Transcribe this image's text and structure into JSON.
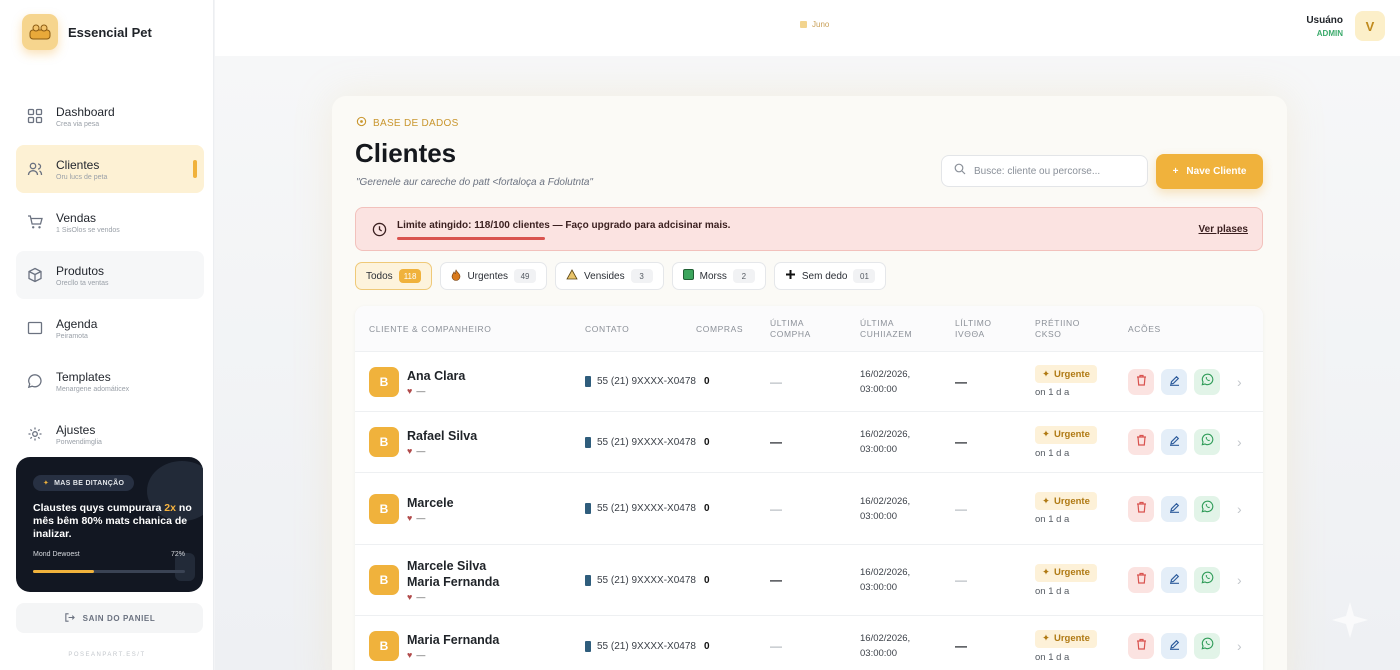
{
  "brand": {
    "name": "Essencial Pet",
    "logo_icon": "pet-logo-icon"
  },
  "sidebar": {
    "items": [
      {
        "label": "Dashboard",
        "sub": "Crea via pesa",
        "icon": "grid-icon",
        "key": "dashboard"
      },
      {
        "label": "Clientes",
        "sub": "Oru lucs de peta",
        "icon": "users-icon",
        "key": "clientes",
        "active": true
      },
      {
        "label": "Vendas",
        "sub": "1 SisOlos se vendos",
        "icon": "cart-icon",
        "key": "vendas"
      },
      {
        "label": "Produtos",
        "sub": "Orecllo ta ventas",
        "icon": "box-icon",
        "key": "produtos"
      },
      {
        "label": "Agenda",
        "sub": "Peiramota",
        "icon": "calendar-icon",
        "key": "agenda"
      },
      {
        "label": "Templates",
        "sub": "Menargene adomáticex",
        "icon": "chat-icon",
        "key": "templates"
      },
      {
        "label": "Ajustes",
        "sub": "Porwendimglia",
        "icon": "gear-icon",
        "key": "ajustes"
      }
    ],
    "promo": {
      "pill": "MAS BE DITANÇÃO",
      "title_pre": "Claustes quys cumpurara ",
      "title_hl": "2x",
      "title_post": " no mês bêm 80% mats chanica de inalizar.",
      "meta_label": "Mond Dewoest",
      "meta_value": "72%",
      "progress": 0.72
    },
    "logout": "SAIN DO PANIEL",
    "footer": "POSEANPART.ES/T"
  },
  "topbar": {
    "center": "Juno",
    "user_name": "Usuáno",
    "user_role": "ADMIN",
    "avatar_letter": "V"
  },
  "page": {
    "crumb": "BASE DE DADOS",
    "title": "Clientes",
    "subtitle": "\"Gerenele aur careche do patt <fortaloça a Fdolutnta\"",
    "search_placeholder": "Busce: cliente ou percorse...",
    "new_button": "Nave Cliente"
  },
  "alert": {
    "text": "Limite atingido: 118/100 clientes — Faço upgrado para adcisinar mais.",
    "link": "Ver plases"
  },
  "filters": [
    {
      "label": "Todos",
      "count": "118",
      "icon": "",
      "active": true
    },
    {
      "label": "Urgentes",
      "count": "49",
      "icon": "fire-icon"
    },
    {
      "label": "Vensides",
      "count": "3",
      "icon": "warning-icon"
    },
    {
      "label": "Morss",
      "count": "2",
      "icon": "green-square-icon"
    },
    {
      "label": "Sem dedo",
      "count": "01",
      "icon": "plus-icon"
    }
  ],
  "table": {
    "headers": [
      "CLIENTE & COMPANHEIRO",
      "CONTATO",
      "COMPRAS",
      "ÚLTIMA COMPHA",
      "ÚLTIMA CUHIIAZEM",
      "LÍLTIMO IVΘΘΑ",
      "PRÉTIINO CKSO",
      "ACÕES"
    ],
    "rows": [
      {
        "initial": "B",
        "name": "Ana Clara",
        "pet": "—",
        "phone": "55 (21) 9XXXX-X0478",
        "compras": "0",
        "ultima_compra": "—",
        "ultima_data": "16/02/2026,",
        "ultima_hora": "03:00:00",
        "ultimo_envio": "—",
        "status": "Urgente",
        "since": "on 1 d a"
      },
      {
        "initial": "B",
        "name": "Rafael Silva",
        "pet": "—",
        "phone": "55 (21) 9XXXX-X0478",
        "compras": "0",
        "ultima_compra": "—",
        "ultima_data": "16/02/2026,",
        "ultima_hora": "03:00:00",
        "ultimo_envio": "—",
        "status": "Urgente",
        "since": "on 1 d a"
      },
      {
        "initial": "B",
        "name": "Marcele",
        "pet": "—",
        "phone": "55 (21) 9XXXX-X0478",
        "compras": "0",
        "ultima_compra": "—",
        "ultima_data": "16/02/2026,",
        "ultima_hora": "03:00:00",
        "ultimo_envio": "—",
        "status": "Urgente",
        "since": "on 1 d a"
      },
      {
        "initial": "B",
        "name": "Marcele Silva\nMaria Fernanda",
        "pet": "—",
        "phone": "55 (21) 9XXXX-X0478",
        "compras": "0",
        "ultima_compra": "—",
        "ultima_data": "16/02/2026,",
        "ultima_hora": "03:00:00",
        "ultimo_envio": "—",
        "status": "Urgente",
        "since": "on 1 d a"
      },
      {
        "initial": "B",
        "name": "Maria Fernanda",
        "pet": "—",
        "phone": "55 (21) 9XXXX-X0478",
        "compras": "0",
        "ultima_compra": "—",
        "ultima_data": "16/02/2026,",
        "ultima_hora": "03:00:00",
        "ultimo_envio": "—",
        "status": "Urgente",
        "since": "on 1 d a"
      }
    ]
  },
  "colors": {
    "accent": "#f0b23c",
    "danger": "#d9534f",
    "success": "#3aaa6b",
    "sidebar_bg": "#ffffff",
    "promo_bg": "#121722"
  }
}
